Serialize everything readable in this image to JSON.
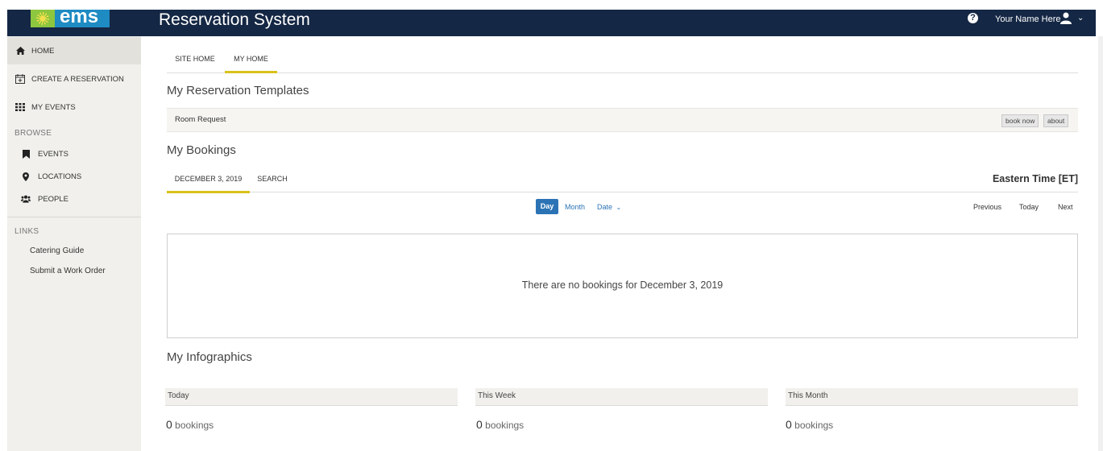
{
  "app": {
    "logo_text": "ems",
    "title": "Reservation System"
  },
  "header": {
    "user_name": "Your Name Here",
    "help_icon": "question-circle-icon",
    "user_icon": "user-icon"
  },
  "sidebar": {
    "items": [
      {
        "label": "HOME",
        "icon": "home-icon"
      },
      {
        "label": "CREATE A RESERVATION",
        "icon": "calendar-plus-icon"
      },
      {
        "label": "MY EVENTS",
        "icon": "grid-icon"
      }
    ],
    "browse_heading": "BROWSE",
    "browse": [
      {
        "label": "EVENTS",
        "icon": "bookmark-icon"
      },
      {
        "label": "LOCATIONS",
        "icon": "map-marker-icon"
      },
      {
        "label": "PEOPLE",
        "icon": "users-icon"
      }
    ],
    "links_heading": "LINKS",
    "links": [
      "Catering Guide",
      "Submit a Work Order"
    ]
  },
  "main": {
    "tabs": [
      "SITE HOME",
      "MY HOME"
    ],
    "templates_title": "My Reservation Templates",
    "template": {
      "name": "Room Request",
      "book_now": "book now",
      "about": "about"
    },
    "bookings_title": "My Bookings",
    "booking_tabs": [
      "DECEMBER 3, 2019",
      "SEARCH"
    ],
    "timezone": "Eastern Time [ET]",
    "views": {
      "day": "Day",
      "month": "Month",
      "date": "Date"
    },
    "nav": {
      "previous": "Previous",
      "today": "Today",
      "next": "Next"
    },
    "empty_message": "There are no bookings for December 3, 2019",
    "infographics_title": "My Infographics",
    "infographics": [
      {
        "label": "Today",
        "count": "0",
        "unit": "bookings"
      },
      {
        "label": "This Week",
        "count": "0",
        "unit": "bookings"
      },
      {
        "label": "This Month",
        "count": "0",
        "unit": "bookings"
      }
    ]
  },
  "colors": {
    "header_bg": "#142744",
    "accent": "#d8c21a",
    "primary_button": "#2c73b5",
    "sidebar_bg": "#f1f0ec"
  }
}
